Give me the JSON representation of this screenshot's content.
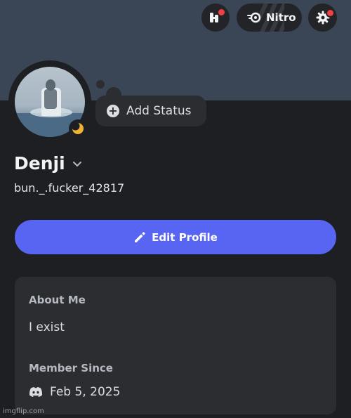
{
  "header": {
    "quests_icon": "quests-icon",
    "nitro_label": "Nitro",
    "nitro_icon": "nitro-icon",
    "settings_icon": "gear-icon"
  },
  "profile": {
    "status_icon": "moon-idle-icon",
    "add_status_label": "Add Status",
    "display_name": "Denji",
    "username": "bun._.fucker_42817",
    "edit_profile_label": "Edit Profile"
  },
  "card": {
    "about_heading": "About Me",
    "about_text": "I exist",
    "member_since_heading": "Member Since",
    "member_since_date": "Feb 5, 2025"
  },
  "watermark": "imgflip.com",
  "colors": {
    "accent": "#5865f2",
    "notification": "#f23f43",
    "idle": "#f0b232",
    "banner": "#3a4656"
  }
}
